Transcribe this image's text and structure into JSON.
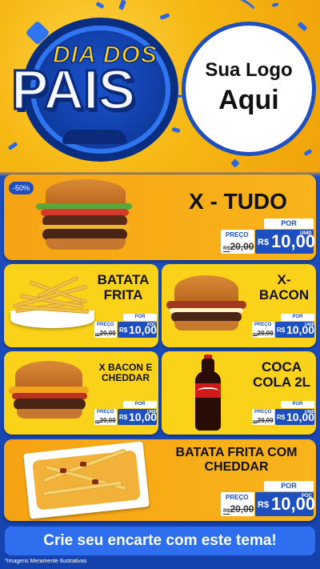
{
  "header": {
    "title_top": "DIA DOS",
    "title_main": "PAIS",
    "logo_line1": "Sua Logo",
    "logo_line2": "Aqui"
  },
  "products": [
    {
      "name": "X - TUDO",
      "badge": "-50%",
      "por": "POR",
      "preco": "PREÇO",
      "old_prefix": "R$",
      "old_value": "20,00",
      "currency": "R$",
      "value": "10,00",
      "unit": "UNID"
    },
    {
      "name_l1": "BATATA",
      "name_l2": "FRITA",
      "por": "POR",
      "preco": "PREÇO",
      "old_prefix": "R$",
      "old_value": "20,00",
      "currency": "R$",
      "value": "10,00",
      "unit": "POÇ"
    },
    {
      "name_l1": "X-",
      "name_l2": "BACON",
      "por": "POR",
      "preco": "PREÇO",
      "old_prefix": "R$",
      "old_value": "20,00",
      "currency": "R$",
      "value": "10,00",
      "unit": "UNID"
    },
    {
      "name_l1": "X BACON E",
      "name_l2": "CHEDDAR",
      "por": "POR",
      "preco": "PREÇO",
      "old_prefix": "R$",
      "old_value": "20,00",
      "currency": "R$",
      "value": "10,00",
      "unit": "UNID"
    },
    {
      "name_l1": "COCA",
      "name_l2": "COLA 2L",
      "por": "POR",
      "preco": "PREÇO",
      "old_prefix": "R$",
      "old_value": "20,00",
      "currency": "R$",
      "value": "10,00",
      "unit": "UNID"
    },
    {
      "name_l1": "BATATA FRITA COM",
      "name_l2": "CHEDDAR",
      "por": "POR",
      "preco": "PREÇO",
      "old_prefix": "R$",
      "old_value": "20,00",
      "currency": "R$",
      "value": "10,00",
      "unit": "POÇ"
    }
  ],
  "cta": "Crie seu encarte com este tema!",
  "footnote": "*Imagens Meramente Ilustrativas",
  "colors": {
    "accent": "#1d4fc1",
    "orange": "#f6a313",
    "yellow": "#fbd21a"
  }
}
